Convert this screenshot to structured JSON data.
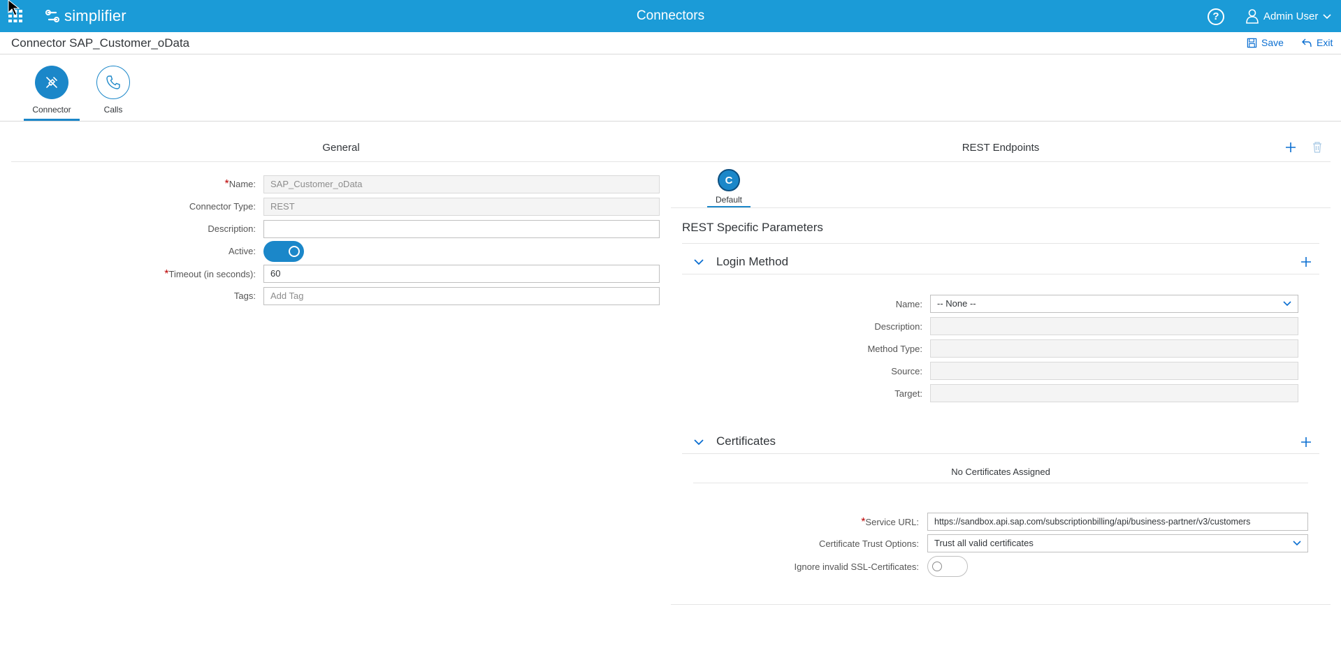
{
  "shell": {
    "logo_text": "simplifier",
    "title": "Connectors",
    "help_symbol": "?",
    "user_name": "Admin User"
  },
  "object_header": {
    "title": "Connector SAP_Customer_oData",
    "save_label": "Save",
    "exit_label": "Exit"
  },
  "tabs": [
    {
      "label": "Connector",
      "icon": "plug-icon",
      "active": true
    },
    {
      "label": "Calls",
      "icon": "phone-icon",
      "active": false
    }
  ],
  "general": {
    "title": "General",
    "required_marker": "*",
    "fields": {
      "name": {
        "label": "Name:",
        "value": "SAP_Customer_oData"
      },
      "connector_type": {
        "label": "Connector Type:",
        "value": "REST"
      },
      "description": {
        "label": "Description:",
        "value": ""
      },
      "active": {
        "label": "Active:",
        "on": true
      },
      "timeout": {
        "label": "Timeout (in seconds):",
        "value": "60"
      },
      "tags": {
        "label": "Tags:",
        "placeholder": "Add Tag"
      }
    }
  },
  "rest_endpoints": {
    "title": "REST Endpoints",
    "endpoint_tab": {
      "letter": "C",
      "label": "Default"
    },
    "specific_params_title": "REST Specific Parameters",
    "login_method": {
      "title": "Login Method",
      "name_label": "Name:",
      "name_value": "-- None --",
      "description_label": "Description:",
      "method_type_label": "Method Type:",
      "source_label": "Source:",
      "target_label": "Target:"
    },
    "certificates": {
      "title": "Certificates",
      "empty_text": "No Certificates Assigned"
    },
    "service_url": {
      "label": "Service URL:",
      "value": "https://sandbox.api.sap.com/subscriptionbilling/api/business-partner/v3/customers"
    },
    "certificate_trust": {
      "label": "Certificate Trust Options:",
      "value": "Trust all valid certificates"
    },
    "ignore_ssl": {
      "label": "Ignore invalid SSL-Certificates:",
      "on": false
    }
  },
  "colors": {
    "shell_bg": "#1b9bd7",
    "accent": "#1b87c9",
    "link": "#0a6ed1",
    "required": "#bb0000"
  }
}
